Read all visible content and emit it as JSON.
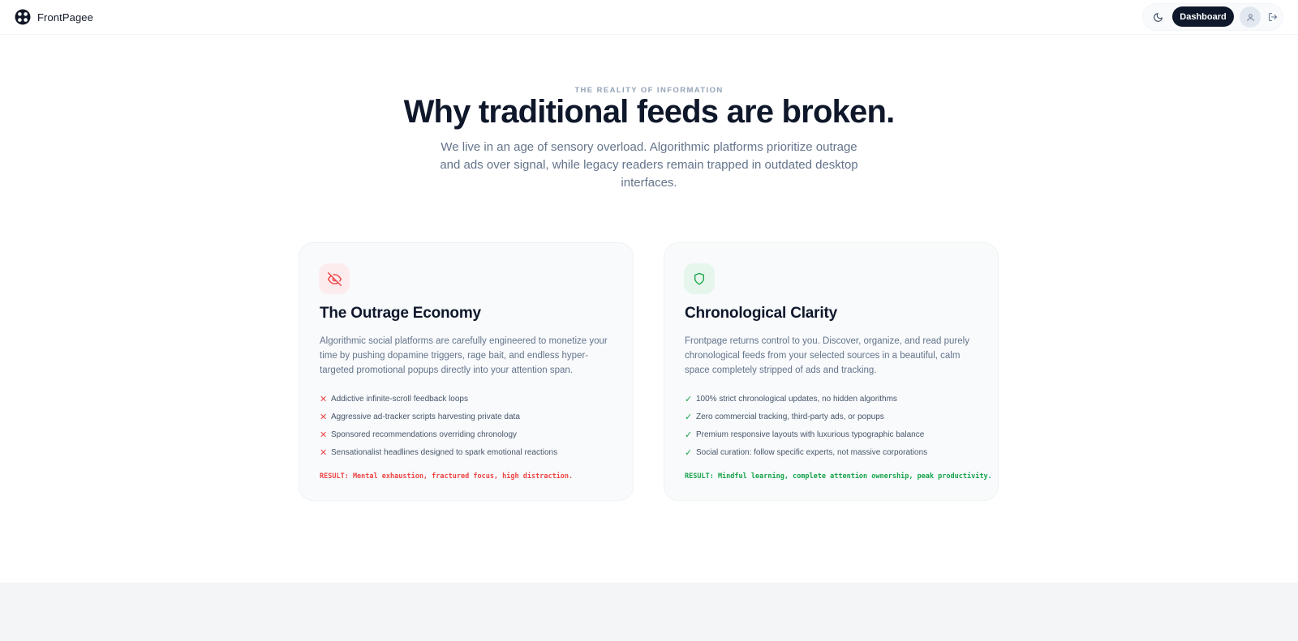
{
  "header": {
    "brand_name": "FrontPagee",
    "dashboard_label": "Dashboard"
  },
  "icons": {
    "brand": "brand-logo-icon",
    "theme": "moon-icon",
    "avatar": "user-icon",
    "logout": "logout-icon",
    "outrage": "eye-off-icon",
    "clarity": "shield-icon"
  },
  "hero": {
    "eyebrow": "THE REALITY OF INFORMATION",
    "title": "Why traditional feeds are broken.",
    "subtitle": "We live in an age of sensory overload. Algorithmic platforms prioritize outrage and ads over signal, while legacy readers remain trapped in outdated desktop interfaces."
  },
  "cards": [
    {
      "title": "The Outrage Economy",
      "body": "Algorithmic social platforms are carefully engineered to monetize your time by pushing dopamine triggers, rage bait, and endless hyper-targeted promotional popups directly into your attention span.",
      "mark": "✕",
      "items": [
        "Addictive infinite-scroll feedback loops",
        "Aggressive ad-tracker scripts harvesting private data",
        "Sponsored recommendations overriding chronology",
        "Sensationalist headlines designed to spark emotional reactions"
      ],
      "result": "RESULT: Mental exhaustion, fractured focus, high distraction."
    },
    {
      "title": "Chronological Clarity",
      "body": "Frontpage returns control to you. Discover, organize, and read purely chronological feeds from your selected sources in a beautiful, calm space completely stripped of ads and tracking.",
      "mark": "✓",
      "items": [
        "100% strict chronological updates, no hidden algorithms",
        "Zero commercial tracking, third-party ads, or popups",
        "Premium responsive layouts with luxurious typographic balance",
        "Social curation: follow specific experts, not massive corporations"
      ],
      "result": "RESULT: Mindful learning, complete attention ownership, peak productivity."
    }
  ],
  "colors": {
    "accent_dark": "#0f172a",
    "negative": "#ef4444",
    "positive": "#16a34a",
    "muted_text": "#64748b"
  }
}
